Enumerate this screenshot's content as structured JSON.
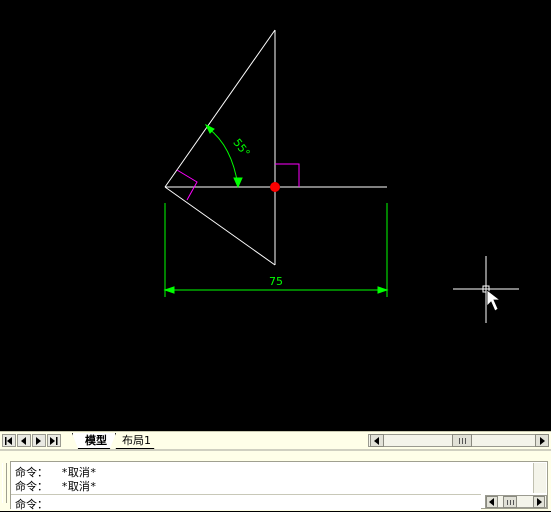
{
  "drawing": {
    "angle_label": "55°",
    "dimension_label": "75",
    "colors": {
      "background": "#000000",
      "geometry": "#ffffff",
      "dimension": "#00ff00",
      "marker": "#ff0000",
      "right_angle": "#ff00ff"
    }
  },
  "tabs": {
    "model": "模型",
    "layout1": "布局1"
  },
  "command_history": [
    "命令：  *取消*",
    "命令：  *取消*"
  ],
  "command_prompt": "命令："
}
